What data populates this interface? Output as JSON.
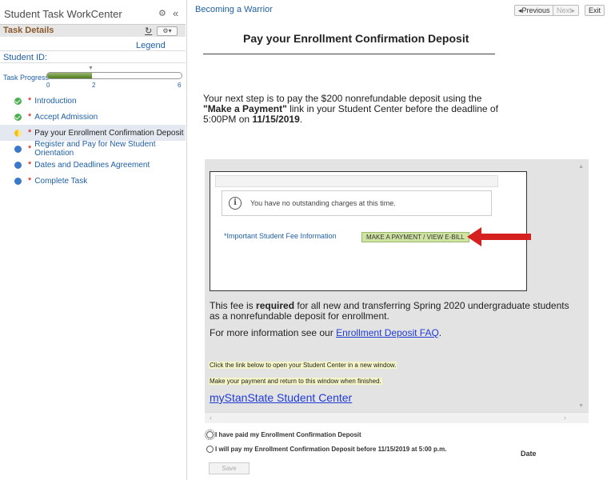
{
  "sidebar": {
    "title": "Student Task WorkCenter",
    "collapse_glyph": "«",
    "task_details_label": "Task Details",
    "legend_label": "Legend",
    "student_id_label": "Student ID:",
    "progress": {
      "label": "Task Progress",
      "ticks": [
        "0",
        "2",
        "6"
      ],
      "completed": 2,
      "total": 6
    },
    "steps": [
      {
        "label": "Introduction",
        "status": "complete",
        "required": "*"
      },
      {
        "label": "Accept Admission",
        "status": "complete",
        "required": "*"
      },
      {
        "label": "Pay your Enrollment Confirmation Deposit",
        "status": "in-progress",
        "required": "*"
      },
      {
        "label": "Register and Pay for New Student Orientation",
        "status": "pending",
        "required": "*"
      },
      {
        "label": "Dates and Deadlines Agreement",
        "status": "pending",
        "required": "*"
      },
      {
        "label": "Complete Task",
        "status": "pending",
        "required": "*"
      }
    ]
  },
  "header": {
    "breadcrumb": "Becoming a Warrior",
    "previous_label": "◂Previous",
    "next_label": "Next▸",
    "exit_label": "Exit"
  },
  "content": {
    "title": "Pay your Enrollment Confirmation Deposit",
    "intro_part1": "Your next step is to pay the $200 nonrefundable deposit using the ",
    "intro_bold_link": "\"Make a Payment\"",
    "intro_part2": " link in your Student Center before the deadline of 5:00PM on ",
    "intro_date": "11/15/2019",
    "intro_end": "."
  },
  "embedded": {
    "notice_text": "You have no outstanding charges at this time.",
    "fee_link": "*Important Student Fee Information",
    "pay_button": "MAKE A PAYMENT / VIEW E-BILL",
    "fee_part1": "This fee is ",
    "fee_bold": "required",
    "fee_part2": " for all new and transferring Spring 2020 undergraduate students as a nonrefundable deposit for enrollment.",
    "faq_part1": "For more information see our ",
    "faq_link": "Enrollment Deposit FAQ",
    "faq_end": ".",
    "note1": "Click the link below to open your Student Center in a new window.",
    "note2": "Make your payment and return to this window when finished.",
    "center_link": "myStanState Student Center"
  },
  "form": {
    "option_paid": "I have paid my Enrollment Confirmation Deposit",
    "option_will_pay": "I will pay my Enrollment Confirmation Deposit before 11/15/2019 at 5:00 p.m.",
    "date_label": "Date",
    "save_label": "Save"
  },
  "colors": {
    "link": "#1f5fa6",
    "task_header": "#8b5a2b",
    "progress_fill": "#4f7a20",
    "arrow": "#d62020"
  }
}
